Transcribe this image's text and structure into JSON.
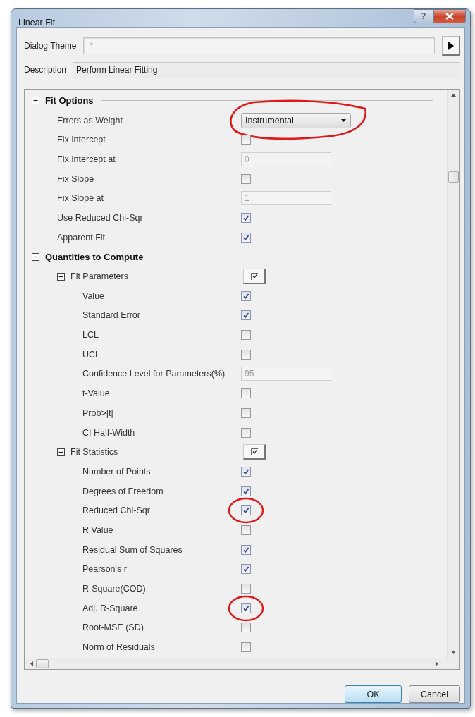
{
  "window": {
    "title": "Linear Fit",
    "help_glyph": "?"
  },
  "theme": {
    "label": "Dialog Theme",
    "value": "*"
  },
  "description": {
    "label": "Description",
    "value": "Perform Linear Fitting"
  },
  "tree": [
    {
      "kind": "section",
      "label": "Fit Options",
      "expanded": true,
      "children": [
        {
          "kind": "dropdown",
          "label": "Errors as Weight",
          "value": "Instrumental",
          "circled": true
        },
        {
          "kind": "checkbox",
          "label": "Fix Intercept",
          "checked": false,
          "circled": false
        },
        {
          "kind": "text",
          "label": "Fix Intercept at",
          "value": "0",
          "disabled": true
        },
        {
          "kind": "checkbox",
          "label": "Fix Slope",
          "checked": false,
          "circled": false
        },
        {
          "kind": "text",
          "label": "Fix Slope at",
          "value": "1",
          "disabled": true
        },
        {
          "kind": "checkbox",
          "label": "Use Reduced Chi-Sqr",
          "checked": true,
          "circled": false
        },
        {
          "kind": "checkbox",
          "label": "Apparent Fit",
          "checked": true,
          "circled": false
        }
      ]
    },
    {
      "kind": "section",
      "label": "Quantities to Compute",
      "expanded": true,
      "children": [
        {
          "kind": "group",
          "label": "Fit Parameters",
          "expanded": true,
          "children": [
            {
              "kind": "checkbox",
              "label": "Value",
              "checked": true,
              "circled": false
            },
            {
              "kind": "checkbox",
              "label": "Standard Error",
              "checked": true,
              "circled": false
            },
            {
              "kind": "checkbox",
              "label": "LCL",
              "checked": false,
              "circled": false
            },
            {
              "kind": "checkbox",
              "label": "UCL",
              "checked": false,
              "circled": false
            },
            {
              "kind": "text",
              "label": "Confidence Level for Parameters(%)",
              "value": "95",
              "disabled": true
            },
            {
              "kind": "checkbox",
              "label": "t-Value",
              "checked": false,
              "circled": false
            },
            {
              "kind": "checkbox",
              "label": "Prob>|t|",
              "checked": false,
              "circled": false
            },
            {
              "kind": "checkbox",
              "label": "CI Half-Width",
              "checked": false,
              "circled": false
            }
          ]
        },
        {
          "kind": "group",
          "label": "Fit Statistics",
          "expanded": true,
          "children": [
            {
              "kind": "checkbox",
              "label": "Number of Points",
              "checked": true,
              "circled": false
            },
            {
              "kind": "checkbox",
              "label": "Degrees of Freedom",
              "checked": true,
              "circled": false
            },
            {
              "kind": "checkbox",
              "label": "Reduced Chi-Sqr",
              "checked": true,
              "circled": true
            },
            {
              "kind": "checkbox",
              "label": "R Value",
              "checked": false,
              "circled": false
            },
            {
              "kind": "checkbox",
              "label": "Residual Sum of Squares",
              "checked": true,
              "circled": false
            },
            {
              "kind": "checkbox",
              "label": "Pearson's r",
              "checked": true,
              "circled": false
            },
            {
              "kind": "checkbox",
              "label": "R-Square(COD)",
              "checked": false,
              "circled": false
            },
            {
              "kind": "checkbox",
              "label": "Adj. R-Square",
              "checked": true,
              "circled": true
            },
            {
              "kind": "checkbox",
              "label": "Root-MSE (SD)",
              "checked": false,
              "circled": false
            },
            {
              "kind": "checkbox",
              "label": "Norm of Residuals",
              "checked": false,
              "circled": false
            }
          ]
        }
      ]
    }
  ],
  "buttons": [
    {
      "label": "OK",
      "default": true
    },
    {
      "label": "Cancel",
      "default": false
    }
  ]
}
